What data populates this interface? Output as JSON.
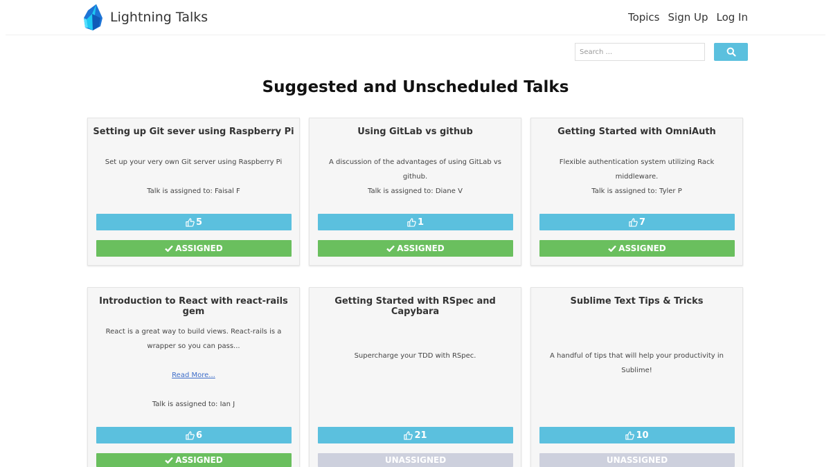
{
  "app": {
    "brand_name": "Lightning Talks"
  },
  "nav": {
    "links": [
      "Topics",
      "Sign Up",
      "Log In"
    ]
  },
  "search": {
    "placeholder": "Search ..."
  },
  "page": {
    "title": "Suggested and Unscheduled Talks"
  },
  "colors": {
    "vote": "#5bc0de",
    "assigned": "#6abf5e",
    "unassigned": "#cdd0dd"
  },
  "talks": [
    {
      "title": "Setting up Git sever using Raspberry Pi",
      "description": "Set up your very own Git server using Raspberry Pi",
      "assigned_to": "Talk is assigned to: Faisal F",
      "votes": "5",
      "status": "ASSIGNED"
    },
    {
      "title": "Using GitLab vs github",
      "description": "A discussion of the advantages of using GitLab vs github.",
      "assigned_to": "Talk is assigned to: Diane V",
      "votes": "1",
      "status": "ASSIGNED"
    },
    {
      "title": "Getting Started with OmniAuth",
      "description": "Flexible authentication system utilizing Rack middleware.",
      "assigned_to": "Talk is assigned to: Tyler P",
      "votes": "7",
      "status": "ASSIGNED"
    },
    {
      "title": "Introduction to React with react-rails gem",
      "description": "React is a great way to build views. React-rails is a wrapper so you can pass...",
      "read_more": "Read More...",
      "assigned_to": "Talk is assigned to: Ian J",
      "votes": "6",
      "status": "ASSIGNED"
    },
    {
      "title": "Getting Started with RSpec and Capybara",
      "description": "Supercharge your TDD with RSpec.",
      "votes": "21",
      "status": "UNASSIGNED"
    },
    {
      "title": "Sublime Text Tips & Tricks",
      "description": "A handful of tips that will help your productivity in Sublime!",
      "votes": "10",
      "status": "UNASSIGNED"
    }
  ]
}
